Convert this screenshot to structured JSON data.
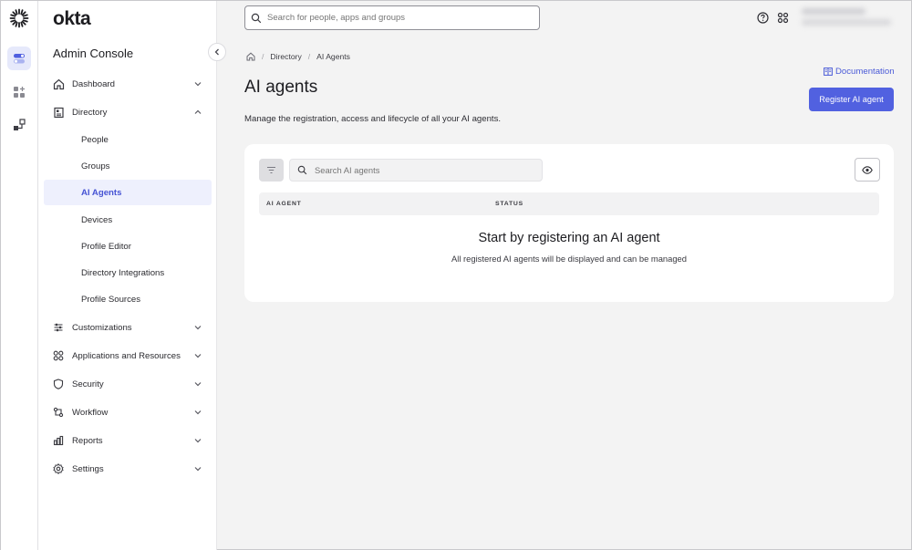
{
  "brand": {
    "name": "okta",
    "console_title": "Admin Console"
  },
  "top": {
    "search_placeholder": "Search for people, apps and groups",
    "help_icon": "help-circle-icon",
    "apps_icon": "grid-icon"
  },
  "sidebar": {
    "items": [
      {
        "label": "Dashboard",
        "icon": "home-icon",
        "expanded": false
      },
      {
        "label": "Directory",
        "icon": "directory-icon",
        "expanded": true
      },
      {
        "label": "Customizations",
        "icon": "sliders-icon",
        "expanded": false
      },
      {
        "label": "Applications and Resources",
        "icon": "apps-icon",
        "expanded": false
      },
      {
        "label": "Security",
        "icon": "shield-icon",
        "expanded": false
      },
      {
        "label": "Workflow",
        "icon": "workflow-icon",
        "expanded": false
      },
      {
        "label": "Reports",
        "icon": "reports-icon",
        "expanded": false
      },
      {
        "label": "Settings",
        "icon": "gear-icon",
        "expanded": false
      }
    ],
    "directory_children": [
      {
        "label": "People"
      },
      {
        "label": "Groups"
      },
      {
        "label": "AI Agents",
        "active": true
      },
      {
        "label": "Devices"
      },
      {
        "label": "Profile Editor"
      },
      {
        "label": "Directory Integrations"
      },
      {
        "label": "Profile Sources"
      }
    ]
  },
  "breadcrumb": {
    "home_icon": "home-icon",
    "items": [
      "Directory",
      "AI Agents"
    ]
  },
  "page": {
    "title": "AI agents",
    "description": "Manage the registration, access and lifecycle of all your AI agents.",
    "documentation_label": "Documentation",
    "register_button": "Register AI agent"
  },
  "table": {
    "search_placeholder": "Search AI agents",
    "columns": [
      "AI AGENT",
      "STATUS"
    ],
    "empty_title": "Start by registering an AI agent",
    "empty_subtitle": "All registered AI agents will be displayed and can be managed"
  },
  "colors": {
    "accent": "#5161e0",
    "active_bg": "#eef0fd",
    "link": "#4a5ad7"
  }
}
